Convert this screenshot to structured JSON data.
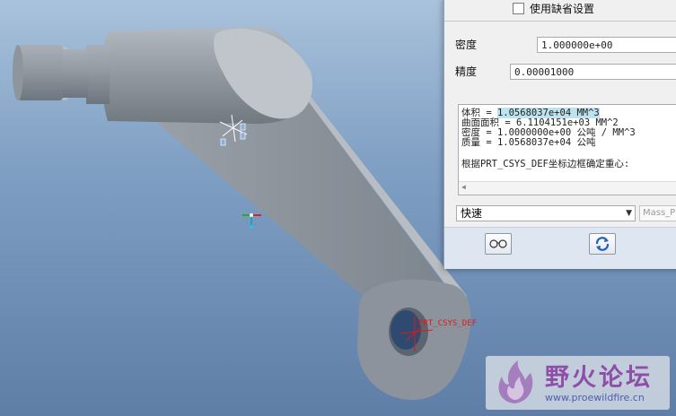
{
  "dialog": {
    "use_default_label": "使用缺省设置",
    "density_label": "密度",
    "density_value": "1.000000e+00",
    "accuracy_label": "精度",
    "accuracy_value": "0.00001000",
    "results": {
      "line1_label": "体积 = ",
      "line1_value": "1.0568037e+04  MM^3",
      "line2": "曲面面积 =  6.1104151e+03  MM^2",
      "line3": "密度 =  1.0000000e+00 公吨 / MM^3",
      "line4": "质量 =  1.0568037e+04 公吨",
      "line5": "根据PRT_CSYS_DEF坐标边框确定重心:"
    },
    "mode_selected": "快速",
    "name_placeholder": "Mass_P"
  },
  "viewport": {
    "csys_label": "PRT_CSYS_DEF",
    "colors": {
      "model": "#8c939c",
      "csys_label": "#e01818"
    }
  },
  "watermark": {
    "title": "野火论坛",
    "url": "www.proewildfire.cn"
  },
  "icons": [
    "glasses-icon",
    "regenerate-icon",
    "flame-logo-icon",
    "csys-axis-icon",
    "checkbox-icon",
    "chevron-down-icon"
  ]
}
